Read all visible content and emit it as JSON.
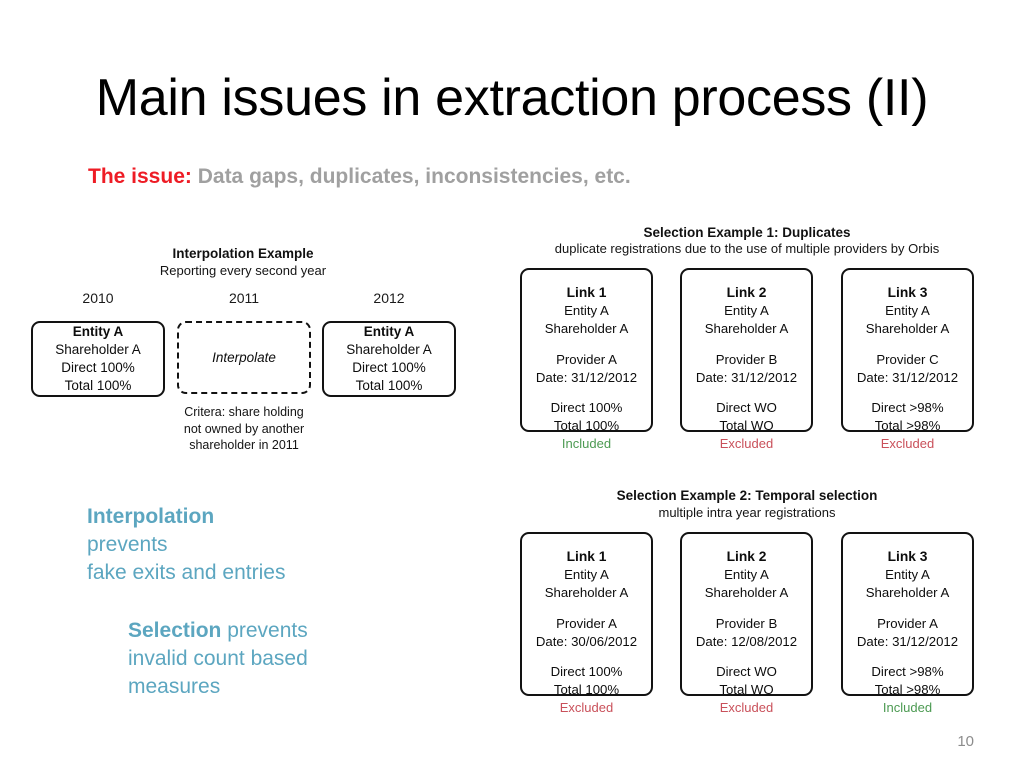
{
  "slide": {
    "title": "Main issues in extraction process (II)",
    "issue_label": "The issue:",
    "issue_text": "Data gaps, duplicates, inconsistencies, etc.",
    "page_number": "10",
    "colors": {
      "issue_label_red": "#EE1C25",
      "issue_text_gray": "#A0A0A0",
      "teal": "#5CA6C0",
      "included_green": "#4C9A52",
      "excluded_red": "#C9505A",
      "box_border": "#121212"
    }
  },
  "interpolation_example": {
    "title": "Interpolation Example",
    "subtitle": "Reporting every second year",
    "years": [
      "2010",
      "2011",
      "2012"
    ],
    "boxes": [
      {
        "style": "solid",
        "heading": "Entity A",
        "lines": [
          "Shareholder A",
          "Direct 100%",
          "Total 100%"
        ]
      },
      {
        "style": "dashed",
        "heading": "",
        "lines": [
          "Interpolate"
        ]
      },
      {
        "style": "solid",
        "heading": "Entity A",
        "lines": [
          "Shareholder A",
          "Direct 100%",
          "Total 100%"
        ]
      }
    ],
    "criteria": [
      "Critera: share holding",
      "not owned by another",
      "shareholder in 2011"
    ]
  },
  "selection_example_1": {
    "title": "Selection Example 1: Duplicates",
    "subtitle": "duplicate registrations due to the use of multiple providers by Orbis",
    "cards": [
      {
        "title": "Link 1",
        "entity": "Entity A",
        "shareholder": "Shareholder A",
        "provider": "Provider A",
        "date": "Date: 31/12/2012",
        "direct": "Direct 100%",
        "total": "Total 100%",
        "status": "Included",
        "status_type": "included"
      },
      {
        "title": "Link 2",
        "entity": "Entity A",
        "shareholder": "Shareholder A",
        "provider": "Provider B",
        "date": "Date: 31/12/2012",
        "direct": "Direct WO",
        "total": "Total WO",
        "status": "Excluded",
        "status_type": "excluded"
      },
      {
        "title": "Link 3",
        "entity": "Entity A",
        "shareholder": "Shareholder A",
        "provider": "Provider C",
        "date": "Date: 31/12/2012",
        "direct": "Direct >98%",
        "total": "Total >98%",
        "status": "Excluded",
        "status_type": "excluded"
      }
    ]
  },
  "selection_example_2": {
    "title": "Selection Example 2: Temporal selection",
    "subtitle": "multiple intra year registrations",
    "cards": [
      {
        "title": "Link 1",
        "entity": "Entity A",
        "shareholder": "Shareholder A",
        "provider": "Provider A",
        "date": "Date: 30/06/2012",
        "direct": "Direct 100%",
        "total": "Total 100%",
        "status": "Excluded",
        "status_type": "excluded"
      },
      {
        "title": "Link 2",
        "entity": "Entity A",
        "shareholder": "Shareholder A",
        "provider": "Provider B",
        "date": "Date: 12/08/2012",
        "direct": "Direct WO",
        "total": "Total WO",
        "status": "Excluded",
        "status_type": "excluded"
      },
      {
        "title": "Link 3",
        "entity": "Entity A",
        "shareholder": "Shareholder A",
        "provider": "Provider A",
        "date": "Date: 31/12/2012",
        "direct": "Direct >98%",
        "total": "Total >98%",
        "status": "Included",
        "status_type": "included"
      }
    ]
  },
  "callouts": [
    {
      "bold": "Interpolation",
      "lines": [
        "prevents",
        "fake exits and entries"
      ]
    },
    {
      "bold": "Selection",
      "first_line_rest": " prevents",
      "lines": [
        "invalid count based",
        "measures"
      ]
    }
  ]
}
